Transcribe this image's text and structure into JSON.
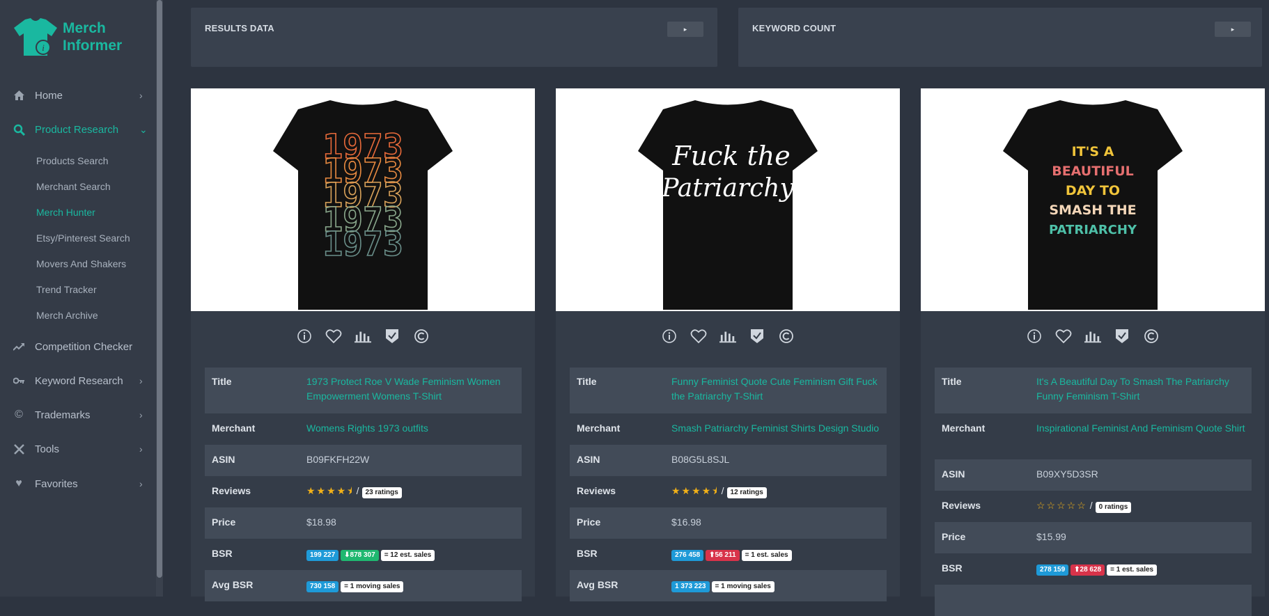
{
  "brand": {
    "line1": "Merch",
    "line2": "Informer",
    "color": "#1ab8a0"
  },
  "sidebar": {
    "items": [
      {
        "label": "Home",
        "icon": "home-icon"
      },
      {
        "label": "Product Research",
        "icon": "search-icon"
      },
      {
        "label": "Competition Checker",
        "icon": "trend-icon"
      },
      {
        "label": "Keyword Research",
        "icon": "key-icon"
      },
      {
        "label": "Trademarks",
        "icon": "copyright-icon"
      },
      {
        "label": "Tools",
        "icon": "tools-icon"
      },
      {
        "label": "Favorites",
        "icon": "heart-icon"
      }
    ],
    "subitems": [
      {
        "label": "Products Search"
      },
      {
        "label": "Merchant Search"
      },
      {
        "label": "Merch Hunter"
      },
      {
        "label": "Etsy/Pinterest Search"
      },
      {
        "label": "Movers And Shakers"
      },
      {
        "label": "Trend Tracker"
      },
      {
        "label": "Merch Archive"
      }
    ]
  },
  "panels": {
    "results": {
      "title": "RESULTS DATA",
      "btn": "▸"
    },
    "keywords": {
      "title": "KEYWORD COUNT",
      "btn": "▸"
    }
  },
  "labels": {
    "title": "Title",
    "merchant": "Merchant",
    "asin": "ASIN",
    "reviews": "Reviews",
    "price": "Price",
    "bsr": "BSR",
    "avg_bsr": "Avg BSR",
    "slash": "/"
  },
  "products": [
    {
      "title": "1973 Protect Roe V Wade Feminism Women Empowerment Womens T-Shirt",
      "merchant": "Womens Rights 1973 outfits",
      "asin": "B09FKFH22W",
      "stars": "★★★★⯨",
      "rating_value": 4.5,
      "ratings": "23 ratings",
      "price": "$18.98",
      "bsr": "199 227",
      "bsr_change": "⬇878 307",
      "bsr_sales": "= 12 est. sales",
      "avg_bsr": "730 158",
      "avg_sales": "= 1 moving sales",
      "design_text": "1973"
    },
    {
      "title": "Funny Feminist Quote Cute Feminism Gift Fuck the Patriarchy T-Shirt",
      "merchant": "Smash Patriarchy Feminist Shirts Design Studio",
      "asin": "B08G5L8SJL",
      "stars": "★★★★⯨",
      "rating_value": 4.5,
      "ratings": "12 ratings",
      "price": "$16.98",
      "bsr": "276 458",
      "bsr_change": "⬆56 211",
      "bsr_sales": "= 1 est. sales",
      "avg_bsr": "1 373 223",
      "avg_sales": "= 1 moving sales",
      "design_line1": "Fuck the",
      "design_line2": "Patriarchy"
    },
    {
      "title": "It's A Beautiful Day To Smash The Patriarchy Funny Feminism T-Shirt",
      "merchant": "Inspirational Feminist And Feminism Quote Shirt",
      "asin": "B09XY5D3SR",
      "stars": "☆☆☆☆☆",
      "rating_value": 0,
      "ratings": "0 ratings",
      "price": "$15.99",
      "bsr": "278 159",
      "bsr_change": "⬆28 628",
      "bsr_sales": "= 1 est. sales",
      "design_lines": [
        "IT'S A",
        "BEAUTIFUL",
        "DAY TO",
        "SMASH THE",
        "PATRIARCHY"
      ]
    }
  ]
}
